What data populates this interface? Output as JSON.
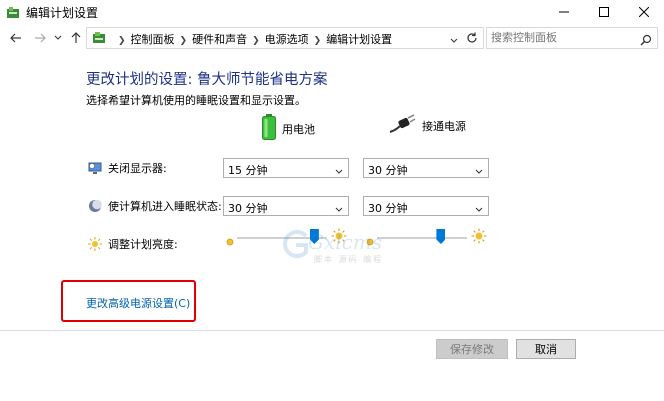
{
  "window": {
    "title": "编辑计划设置"
  },
  "nav": {
    "breadcrumbs": [
      "控制面板",
      "硬件和声音",
      "电源选项",
      "编辑计划设置"
    ],
    "search_placeholder": "搜索控制面板"
  },
  "main": {
    "heading": "更改计划的设置: 鲁大师节能省电方案",
    "subtitle": "选择希望计算机使用的睡眠设置和显示设置。",
    "columns": {
      "battery": "用电池",
      "plugged": "接通电源"
    },
    "rows": {
      "display": {
        "label": "关闭显示器:",
        "battery_value": "15 分钟",
        "plugged_value": "30 分钟"
      },
      "sleep": {
        "label": "使计算机进入睡眠状态:",
        "battery_value": "30 分钟",
        "plugged_value": "30 分钟"
      },
      "brightness": {
        "label": "调整计划亮度:",
        "battery_level": 0.86,
        "plugged_level": 0.71
      }
    },
    "advanced_link": "更改高级电源设置(C)"
  },
  "watermark": {
    "text": "Gxlcms",
    "sub": "脚本 源码 编程"
  },
  "footer": {
    "save_label": "保存修改",
    "cancel_label": "取消"
  },
  "colors": {
    "heading": "#1e3287",
    "link": "#0063b1",
    "highlight": "#e00000",
    "slider_thumb": "#0078d7"
  }
}
